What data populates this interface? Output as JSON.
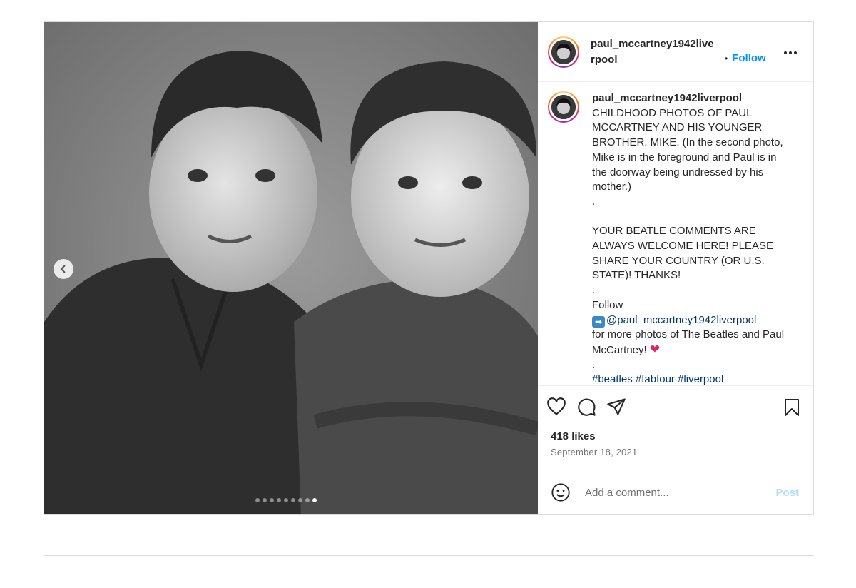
{
  "post": {
    "username": "paul_mccartney1942liverpool",
    "follow_label": "Follow",
    "bullet": "•",
    "carousel": {
      "total_slides": 9,
      "active_index": 8
    }
  },
  "caption": {
    "username": "paul_mccartney1942liverpool",
    "line1": "CHILDHOOD PHOTOS OF PAUL MCCARTNEY AND HIS YOUNGER BROTHER, MIKE. (In the second photo, Mike is in the foreground and Paul is in the doorway being undressed by his mother.)",
    "dot1": ".",
    "line2": "YOUR BEATLE COMMENTS ARE ALWAYS WELCOME HERE! PLEASE SHARE YOUR COUNTRY (OR U.S. STATE)! THANKS!",
    "dot2": ".",
    "follow_word": "Follow",
    "mention": "@paul_mccartney1942liverpool",
    "line3": "for more photos of The Beatles and Paul McCartney!",
    "dot3": ".",
    "hashtags": "#beatles #fabfour #liverpool"
  },
  "stats": {
    "likes": "418 likes",
    "date": "September 18, 2021"
  },
  "comment": {
    "placeholder": "Add a comment...",
    "post_label": "Post"
  },
  "icons": {
    "like": "heart-icon",
    "comment": "comment-icon",
    "share": "share-icon",
    "save": "bookmark-icon",
    "emoji": "emoji-icon",
    "more": "more-icon",
    "prev": "chevron-left-icon"
  }
}
